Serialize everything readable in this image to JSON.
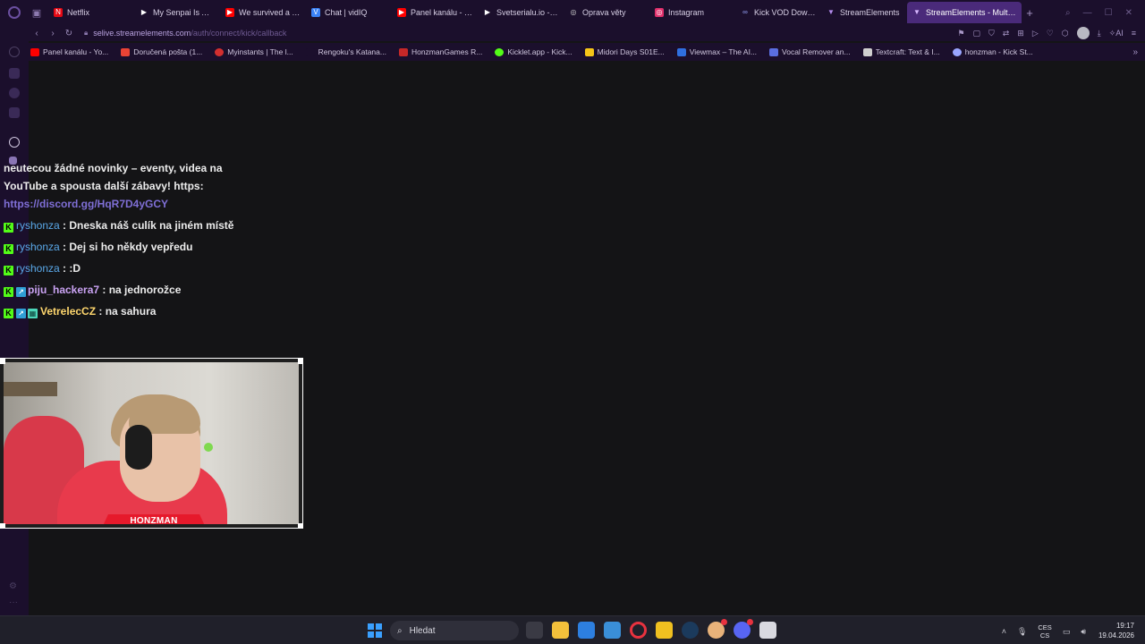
{
  "browser": {
    "tabs": [
      {
        "label": "Netflix",
        "color": "#e50914",
        "glyph": "N"
      },
      {
        "label": "My Senpai Is Annoying",
        "color": "#ffffff",
        "glyph": "▶"
      },
      {
        "label": "We survived a YE",
        "color": "#ff0000",
        "glyph": "▶"
      },
      {
        "label": "Chat | vidIQ",
        "color": "#3b82f6",
        "glyph": "V"
      },
      {
        "label": "Panel kanálu - You",
        "color": "#ff0000",
        "glyph": "▶"
      },
      {
        "label": "Svetserialu.io - On",
        "color": "#ffffff",
        "glyph": "▶"
      },
      {
        "label": "Oprava věty",
        "color": "#d0d0d0",
        "glyph": "◎"
      },
      {
        "label": "Instagram",
        "color": "#e1306c",
        "glyph": "◎"
      },
      {
        "label": "Kick VOD Downloa",
        "color": "#9aa6ff",
        "glyph": "∞"
      },
      {
        "label": "StreamElements",
        "color": "#b58df0",
        "glyph": "▼"
      },
      {
        "label": "StreamElements - Multi-St",
        "color": "#b58df0",
        "glyph": "▼"
      }
    ],
    "active_tab_index": 10,
    "new_tab": "+",
    "url_host": "selive.streamelements.com",
    "url_path": "/auth/connect/kick/callback",
    "ai_label": "AI",
    "bookmarks": [
      {
        "label": "Panel kanálu - Yo...",
        "color": "#ff0000"
      },
      {
        "label": "Doručená pošta (1...",
        "color": "#ea4335"
      },
      {
        "label": "Myinstants | The l...",
        "color": "#d32f2f"
      },
      {
        "label": "Rengoku's Katana...",
        "color": "#1b0f2c"
      },
      {
        "label": "HonzmanGames R...",
        "color": "#c62828"
      },
      {
        "label": "Kicklet.app - Kick...",
        "color": "#53fc18"
      },
      {
        "label": "Midori Days S01E...",
        "color": "#f5c518"
      },
      {
        "label": "Viewmax – The AI...",
        "color": "#2f6fe0"
      },
      {
        "label": "Vocal Remover an...",
        "color": "#5a6ee0"
      },
      {
        "label": "Textcraft: Text & I...",
        "color": "#cfcfcf"
      },
      {
        "label": "honzman - Kick St...",
        "color": "#9aa6ff"
      }
    ],
    "bookmarks_more": "»"
  },
  "chat": {
    "intro_text": "neutecou žádné novinky – eventy, videa na YouTube a spousta další zábavy! https:",
    "intro_link": "https://discord.gg/HqR7D4yGCY",
    "messages": [
      {
        "user": "ryshonza",
        "text": "Dneska náš culík na jiném místě"
      },
      {
        "user": "ryshonza",
        "text": "Dej si ho někdy vepředu"
      },
      {
        "user": "ryshonza",
        "text": ":D"
      },
      {
        "user": "piju_hackera7",
        "text": "na jednorožce"
      },
      {
        "user": "VetrelecCZ",
        "text": "na sahura"
      }
    ],
    "separator": " : "
  },
  "webcam": {
    "nametag": "HONZMAN"
  },
  "taskbar": {
    "search_placeholder": "Hledat",
    "lang_top": "CES",
    "lang_bottom": "CS",
    "time": "19:17",
    "date": "19.04.2026"
  }
}
